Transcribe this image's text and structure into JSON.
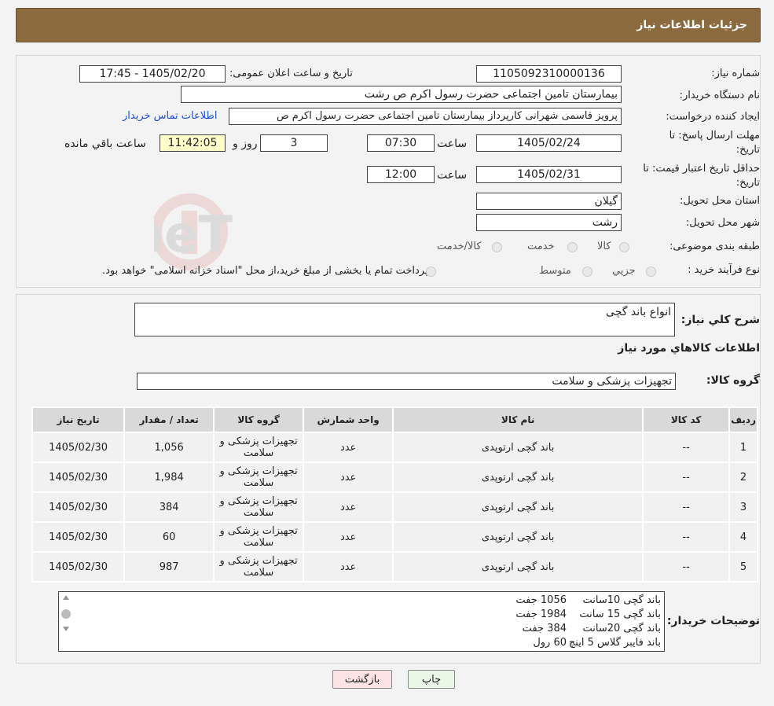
{
  "header": {
    "title": "جزئیات اطلاعات نیاز"
  },
  "form": {
    "need_number_label": "شماره نیاز:",
    "need_number": "1105092310000136",
    "announce_label": "تاریخ و ساعت اعلان عمومی:",
    "announce_value": "1405/02/20 - 17:45",
    "buyer_org_label": "نام دستگاه خریدار:",
    "buyer_org": "بیمارستان  تامین اجتماعی حضرت رسول اکرم ص رشت",
    "requester_label": "ایجاد کننده درخواست:",
    "requester": "پرویز قاسمی شهرانی کارپرداز بیمارستان  تامین اجتماعی حضرت رسول اکرم ص",
    "contact_link": "اطلاعات تماس خریدار",
    "reply_deadline_label_1": "مهلت ارسال پاسخ: تا",
    "reply_deadline_label_2": "تاریخ:",
    "reply_date": "1405/02/24",
    "time_label": "ساعت",
    "reply_time": "07:30",
    "days": "3",
    "days_label": "روز و",
    "remaining_time": "11:42:05",
    "remaining_label": "ساعت باقي مانده",
    "price_validity_label_1": "حداقل تاریخ اعتبار قیمت: تا",
    "price_validity_label_2": "تاریخ:",
    "price_date": "1405/02/31",
    "price_time": "12:00",
    "province_label": "استان محل تحویل:",
    "province": "گیلان",
    "city_label": "شهر محل تحویل:",
    "city": "رشت",
    "category_label": "طبقه بندی موضوعی:",
    "category_options": [
      "کالا",
      "خدمت",
      "کالا/خدمت"
    ],
    "process_label": "نوع فرآیند خرید :",
    "process_options": [
      "جزیي",
      "متوسط"
    ],
    "payment_note": "پرداخت تمام یا بخشی از مبلغ خرید،از محل \"اسناد خزانه اسلامی\" خواهد بود."
  },
  "summary": {
    "desc_label": "شرح کلي نیاز:",
    "desc_value": "انواع باند گچی",
    "goods_info_title": "اطلاعات کالاهاي مورد نیاز",
    "group_label": "گروه کالا:",
    "group_value": "تجهیزات پزشکی و سلامت"
  },
  "table": {
    "headers": [
      "ردیف",
      "کد کالا",
      "نام کالا",
      "واحد شمارش",
      "گروه کالا",
      "تعداد / مقدار",
      "تاریخ نیاز"
    ],
    "rows": [
      [
        "1",
        "--",
        "باند گچی ارتوپدی",
        "عدد",
        "تجهیزات پزشکی و سلامت",
        "1,056",
        "1405/02/30"
      ],
      [
        "2",
        "--",
        "باند گچی ارتوپدی",
        "عدد",
        "تجهیزات پزشکی و سلامت",
        "1,984",
        "1405/02/30"
      ],
      [
        "3",
        "--",
        "باند گچی ارتوپدی",
        "عدد",
        "تجهیزات پزشکی و سلامت",
        "384",
        "1405/02/30"
      ],
      [
        "4",
        "--",
        "باند گچی ارتوپدی",
        "عدد",
        "تجهیزات پزشکی و سلامت",
        "60",
        "1405/02/30"
      ],
      [
        "5",
        "--",
        "باند گچی ارتوپدی",
        "عدد",
        "تجهیزات پزشکی و سلامت",
        "987",
        "1405/02/30"
      ]
    ]
  },
  "notes": {
    "label": "توضیحات خریدار:",
    "lines": [
      [
        "باند گچی 10سانت",
        "1056 جفت"
      ],
      [
        "باند گچی 15 سانت",
        "1984 جفت"
      ],
      [
        "باند گچی 20سانت",
        "384 جفت"
      ],
      [
        "باند فایبر گلاس 5 اینچ",
        "60 رول"
      ]
    ]
  },
  "buttons": {
    "print": "چاپ",
    "back": "بازگشت"
  },
  "watermark": {
    "text": "AriaTender.neT"
  }
}
